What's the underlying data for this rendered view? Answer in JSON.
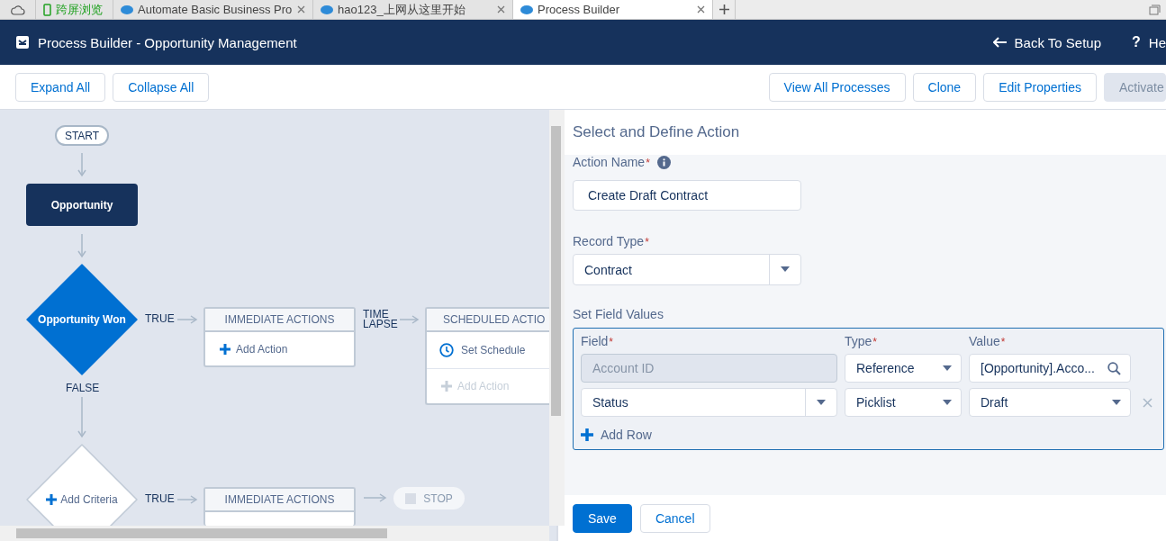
{
  "browser_tabs": [
    {
      "kind": "home",
      "selected": false,
      "closable": false
    },
    {
      "kind": "extension",
      "label": "跨屏浏览",
      "selected": false,
      "closable": false
    },
    {
      "kind": "page",
      "label": "Automate Basic Business Pro",
      "selected": false,
      "closable": true
    },
    {
      "kind": "page",
      "label": "hao123_上网从这里开始",
      "selected": false,
      "closable": true
    },
    {
      "kind": "page",
      "label": "Process Builder",
      "selected": true,
      "closable": true
    }
  ],
  "header": {
    "title": "Process Builder - Opportunity Management",
    "links": [
      {
        "kind": "back",
        "label": "Back To Setup"
      },
      {
        "kind": "help",
        "glyph": "?",
        "label": "He"
      }
    ]
  },
  "toolbar": {
    "left": [
      {
        "label": "Expand All",
        "disabled": false
      },
      {
        "label": "Collapse All",
        "disabled": false
      }
    ],
    "right": [
      {
        "label": "View All Processes",
        "disabled": false
      },
      {
        "label": "Clone",
        "disabled": false
      },
      {
        "label": "Edit Properties",
        "disabled": false
      },
      {
        "label": "Activate",
        "disabled": true
      }
    ]
  },
  "canvas": {
    "start": "START",
    "object": "Opportunity",
    "criteria": [
      {
        "kind": "defined",
        "label": "Opportunity Won",
        "true_label": "TRUE",
        "false_label": "FALSE",
        "immediate": {
          "title": "IMMEDIATE ACTIONS",
          "add": "Add Action"
        },
        "time_lapse": "TIME LAPSE",
        "scheduled": {
          "title": "SCHEDULED ACTIO",
          "schedule": "Set Schedule",
          "add": "Add Action"
        }
      },
      {
        "kind": "new",
        "label": "Add Criteria",
        "true_label": "TRUE",
        "immediate": {
          "title": "IMMEDIATE ACTIONS"
        },
        "stop": "STOP"
      }
    ]
  },
  "panel": {
    "title": "Select and Define Action",
    "action_name": {
      "label": "Action Name",
      "mark": "*",
      "value": "Create Draft Contract"
    },
    "record_type": {
      "label": "Record Type",
      "mark": "*",
      "value": "Contract"
    },
    "field_values": {
      "label": "Set Field Values",
      "columns": [
        {
          "label": "Field",
          "mark": "*"
        },
        {
          "label": "Type",
          "mark": "*"
        },
        {
          "label": "Value",
          "mark": "*"
        }
      ],
      "rows": [
        {
          "field": "Account ID",
          "field_disabled": true,
          "type": "Reference",
          "value": "[Opportunity].Acco...",
          "kind": "lookup",
          "removable": false
        },
        {
          "field": "Status",
          "field_disabled": false,
          "type": "Picklist",
          "value": "Draft",
          "kind": "picklist",
          "removable": true
        }
      ],
      "add_row": "Add Row"
    },
    "buttons": [
      {
        "label": "Save",
        "kind": "brand"
      },
      {
        "label": "Cancel",
        "kind": "neutral"
      }
    ]
  }
}
